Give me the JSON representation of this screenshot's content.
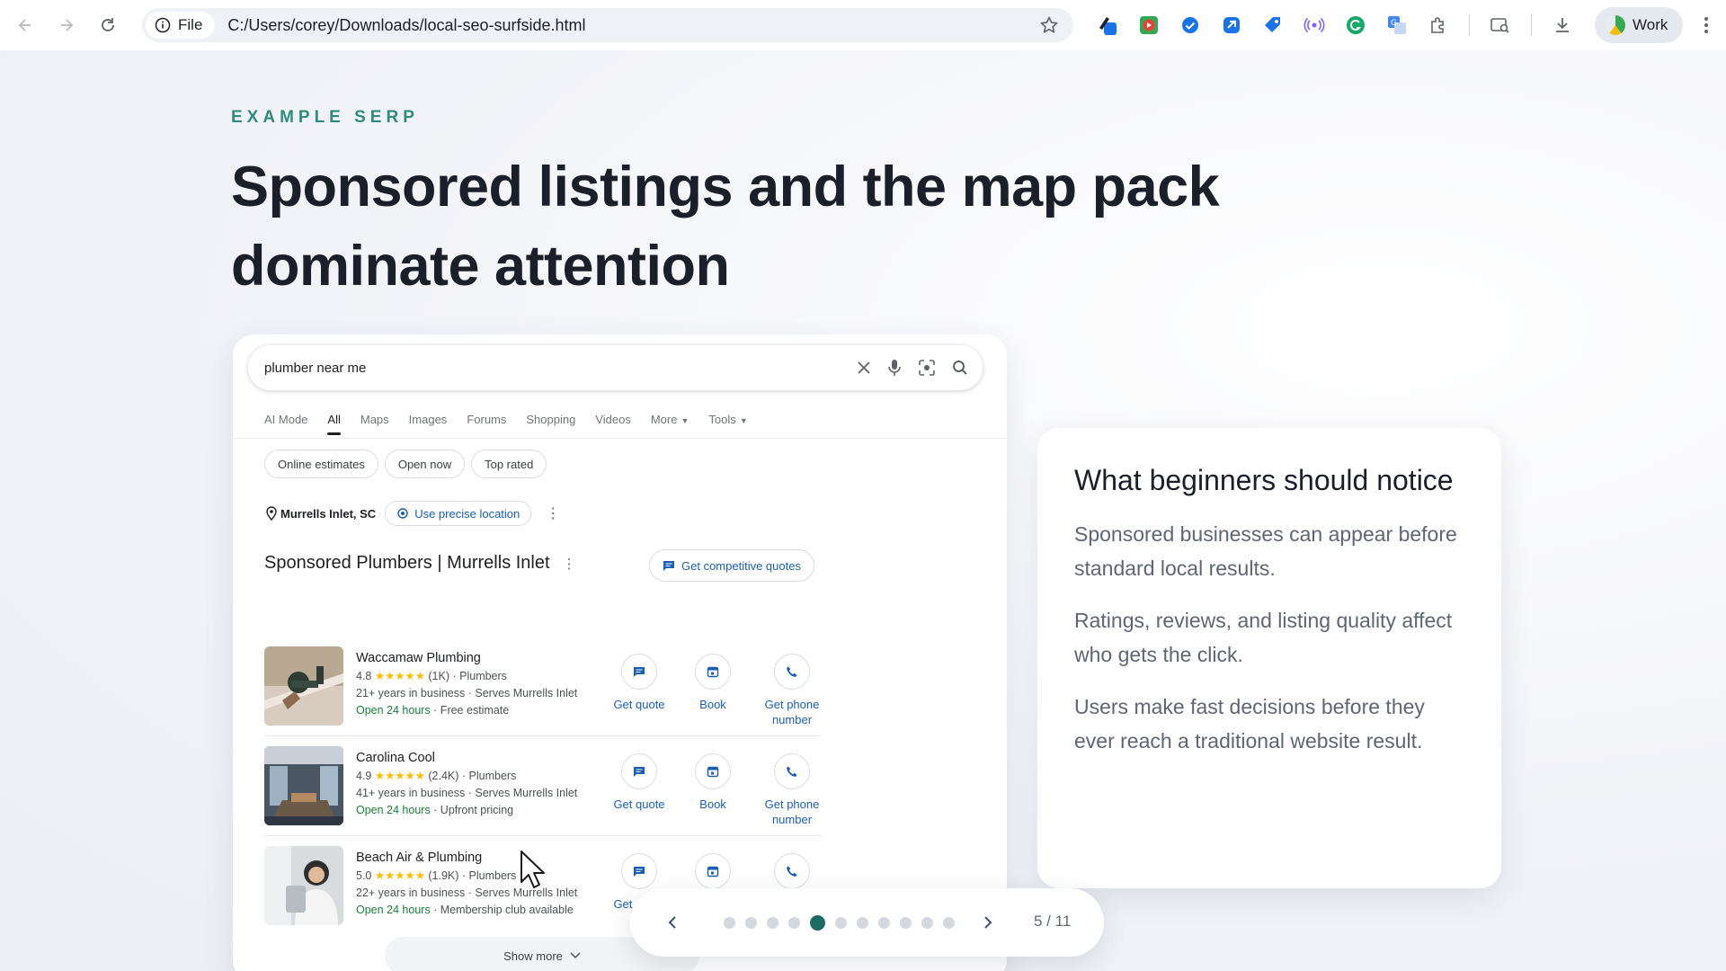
{
  "browser": {
    "site_label": "File",
    "url": "C:/Users/corey/Downloads/local-seo-surfside.html",
    "profile_label": "Work"
  },
  "slide": {
    "eyebrow": "EXAMPLE SERP",
    "headline_line1": "Sponsored listings and the map pack",
    "headline_line2": "dominate attention"
  },
  "serp": {
    "query": "plumber near me",
    "tabs": [
      {
        "label": "AI Mode"
      },
      {
        "label": "All"
      },
      {
        "label": "Maps"
      },
      {
        "label": "Images"
      },
      {
        "label": "Forums"
      },
      {
        "label": "Shopping"
      },
      {
        "label": "Videos"
      },
      {
        "label": "More"
      },
      {
        "label": "Tools"
      }
    ],
    "chips": [
      "Online estimates",
      "Open now",
      "Top rated"
    ],
    "location": "Murrells Inlet, SC",
    "precise_location": "Use precise location",
    "section_title": "Sponsored Plumbers | Murrells Inlet",
    "quotes_button": "Get competitive quotes",
    "actions": {
      "quote": "Get quote",
      "book": "Book",
      "phone_line1": "Get phone",
      "phone_line2": "number"
    },
    "listings": [
      {
        "name": "Waccamaw Plumbing",
        "rating": "4.8",
        "stars": "★★★★★",
        "reviews": "(1K)",
        "category": "Plumbers",
        "years": "21+ years in business · Serves Murrells Inlet",
        "open": "Open 24 hours",
        "extra": " · Free estimate"
      },
      {
        "name": "Carolina Cool",
        "rating": "4.9",
        "stars": "★★★★★",
        "reviews": "(2.4K)",
        "category": "Plumbers",
        "years": "41+ years in business · Serves Murrells Inlet",
        "open": "Open 24 hours",
        "extra": " · Upfront pricing"
      },
      {
        "name": "Beach Air & Plumbing",
        "rating": "5.0",
        "stars": "★★★★★",
        "reviews": "(1.9K)",
        "category": "Plumbers",
        "years": "22+ years in business · Serves Murrells Inlet",
        "open": "Open 24 hours",
        "extra": " · Membership club available"
      }
    ],
    "show_more": "Show more"
  },
  "notice": {
    "title": "What beginners should notice",
    "points": [
      "Sponsored businesses can appear before standard local results.",
      "Ratings, reviews, and listing quality affect who gets the click.",
      "Users make fast decisions before they ever reach a traditional website result."
    ]
  },
  "pager": {
    "current": 5,
    "total": 11,
    "dot_count": 11,
    "label": "5 / 11"
  },
  "colors": {
    "accent": "#1e6b63",
    "eyebrow": "#2e8b7d",
    "link_blue": "#1a5fb4",
    "open_green": "#188038",
    "star_yellow": "#fbbc04"
  }
}
